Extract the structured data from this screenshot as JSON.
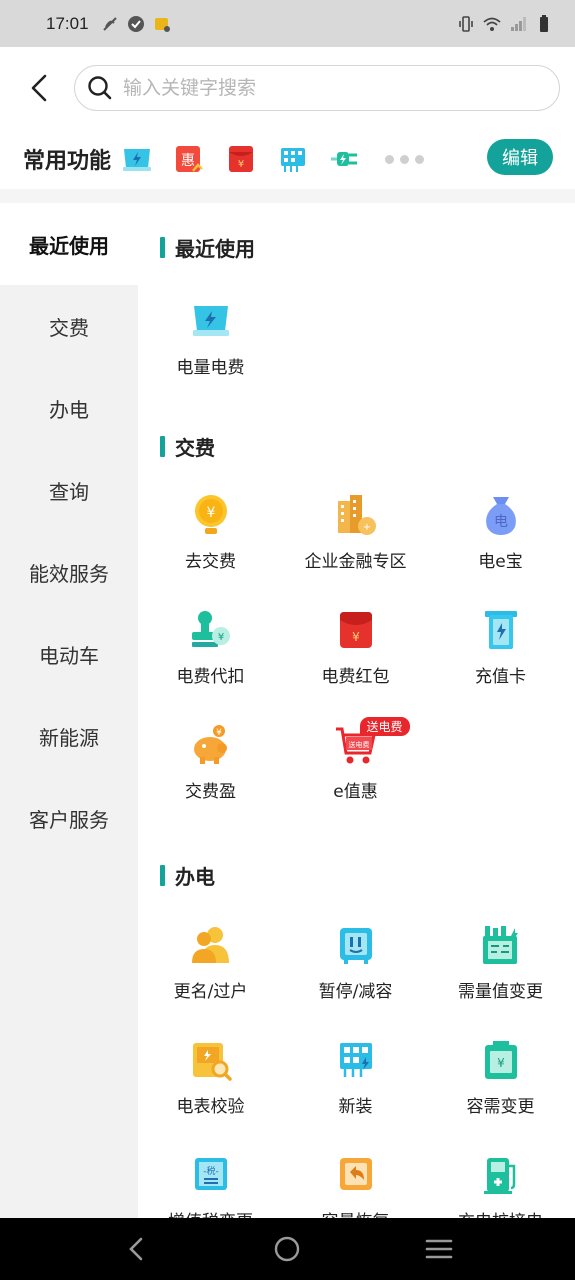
{
  "status_bar": {
    "time": "17:01"
  },
  "search": {
    "placeholder": "输入关键字搜索"
  },
  "common": {
    "title": "常用功能",
    "edit_label": "编辑",
    "icons": [
      "power-bill-icon",
      "discount-icon",
      "red-packet-icon",
      "building-icon",
      "charger-plug-icon"
    ]
  },
  "sidebar": {
    "items": [
      {
        "label": "最近使用",
        "active": true
      },
      {
        "label": "交费"
      },
      {
        "label": "办电"
      },
      {
        "label": "查询"
      },
      {
        "label": "能效服务"
      },
      {
        "label": "电动车"
      },
      {
        "label": "新能源"
      },
      {
        "label": "客户服务"
      }
    ]
  },
  "sections": {
    "recent": {
      "title": "最近使用",
      "items": [
        {
          "label": "电量电费",
          "icon": "power-bill-icon"
        }
      ]
    },
    "payment": {
      "title": "交费",
      "items": [
        {
          "label": "去交费",
          "icon": "coin-bulb-icon"
        },
        {
          "label": "企业金融专区",
          "icon": "enterprise-building-icon"
        },
        {
          "label": "电e宝",
          "icon": "money-bag-icon"
        },
        {
          "label": "电费代扣",
          "icon": "stamp-icon"
        },
        {
          "label": "电费红包",
          "icon": "red-packet-icon"
        },
        {
          "label": "充值卡",
          "icon": "recharge-card-icon"
        },
        {
          "label": "交费盈",
          "icon": "piggy-bank-icon"
        },
        {
          "label": "e值惠",
          "icon": "shopping-cart-icon",
          "badge": "送电费",
          "badge_inner": "送电费"
        }
      ]
    },
    "service": {
      "title": "办电",
      "items": [
        {
          "label": "更名/过户",
          "icon": "users-icon"
        },
        {
          "label": "暂停/减容",
          "icon": "pause-device-icon"
        },
        {
          "label": "需量值变更",
          "icon": "factory-icon"
        },
        {
          "label": "电表校验",
          "icon": "meter-check-icon"
        },
        {
          "label": "新装",
          "icon": "new-install-icon"
        },
        {
          "label": "容需变更",
          "icon": "capacity-change-icon"
        },
        {
          "label": "增值税变更",
          "icon": "tax-icon"
        },
        {
          "label": "容量恢复",
          "icon": "capacity-restore-icon"
        },
        {
          "label": "充电桩接电",
          "icon": "charging-pile-icon"
        }
      ]
    }
  },
  "colors": {
    "accent": "#14a39a",
    "sidebar_bg": "#f2f2f2",
    "badge_red": "#e8262b"
  }
}
